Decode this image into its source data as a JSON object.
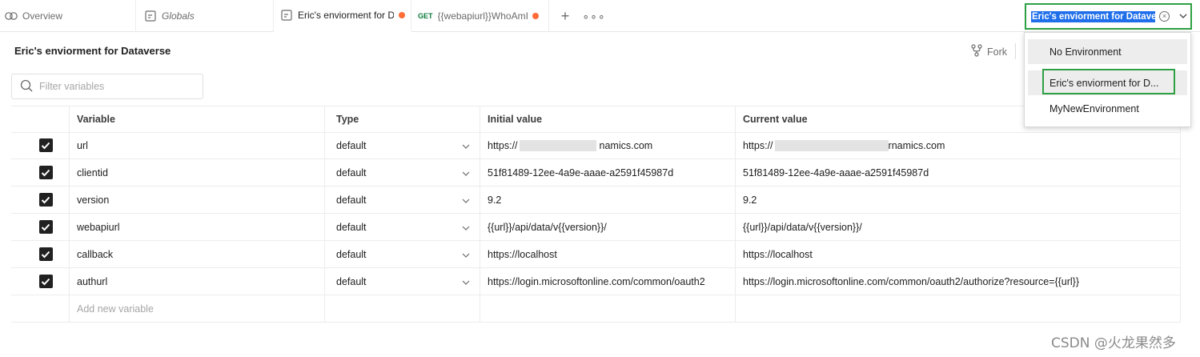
{
  "tabs": [
    {
      "label": "Overview",
      "icon": "people-icon"
    },
    {
      "label": "Globals",
      "icon": "globals-icon"
    },
    {
      "label": "Eric's enviorment for Da",
      "icon": "environment-icon",
      "unsaved": true
    },
    {
      "method": "GET",
      "label": "{{webapiurl}}WhoAmI",
      "unsaved": true
    }
  ],
  "environment_selector": {
    "selected_label": "Eric's enviorment for Dataver",
    "options": [
      "No Environment",
      "Eric's enviorment for D...",
      "MyNewEnvironment"
    ]
  },
  "page": {
    "title": "Eric's enviorment for Dataverse",
    "fork_label": "Fork"
  },
  "filter": {
    "placeholder": "Filter variables"
  },
  "table": {
    "headers": [
      "Variable",
      "Type",
      "Initial value",
      "Current value"
    ],
    "rows": [
      {
        "variable": "url",
        "type": "default",
        "initial_a": "https://",
        "initial_b": "namics.com",
        "current_a": "https://",
        "current_b": "rnamics.com"
      },
      {
        "variable": "clientid",
        "type": "default",
        "initial": "51f81489-12ee-4a9e-aaae-a2591f45987d",
        "current": "51f81489-12ee-4a9e-aaae-a2591f45987d"
      },
      {
        "variable": "version",
        "type": "default",
        "initial": "9.2",
        "current": "9.2"
      },
      {
        "variable": "webapiurl",
        "type": "default",
        "initial": "{{url}}/api/data/v{{version}}/",
        "current": "{{url}}/api/data/v{{version}}/"
      },
      {
        "variable": "callback",
        "type": "default",
        "initial": "https://localhost",
        "current": "https://localhost"
      },
      {
        "variable": "authurl",
        "type": "default",
        "initial": "https://login.microsoftonline.com/common/oauth2",
        "current": "https://login.microsoftonline.com/common/oauth2/authorize?resource={{url}}"
      }
    ],
    "add_placeholder": "Add new variable"
  },
  "watermark": "CSDN @火龙果然多",
  "colors": {
    "accent_orange": "#ff6c37",
    "highlight_green": "#2ea043",
    "selection_blue": "#1f6feb"
  }
}
